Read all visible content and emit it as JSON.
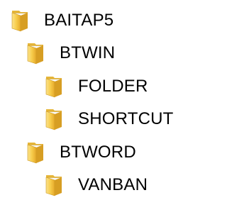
{
  "tree": {
    "root": {
      "label": "BAITAP5",
      "icon": "folder-icon",
      "children": [
        {
          "label": "BTWIN",
          "icon": "folder-icon",
          "children": [
            {
              "label": "FOLDER",
              "icon": "folder-icon"
            },
            {
              "label": "SHORTCUT",
              "icon": "folder-icon"
            }
          ]
        },
        {
          "label": "BTWORD",
          "icon": "folder-icon",
          "children": [
            {
              "label": "VANBAN",
              "icon": "folder-icon"
            }
          ]
        }
      ]
    }
  },
  "colors": {
    "folder_front": "#F5C53E",
    "folder_back": "#D9A520",
    "folder_paper": "#FFFFFF",
    "text": "#000000"
  }
}
